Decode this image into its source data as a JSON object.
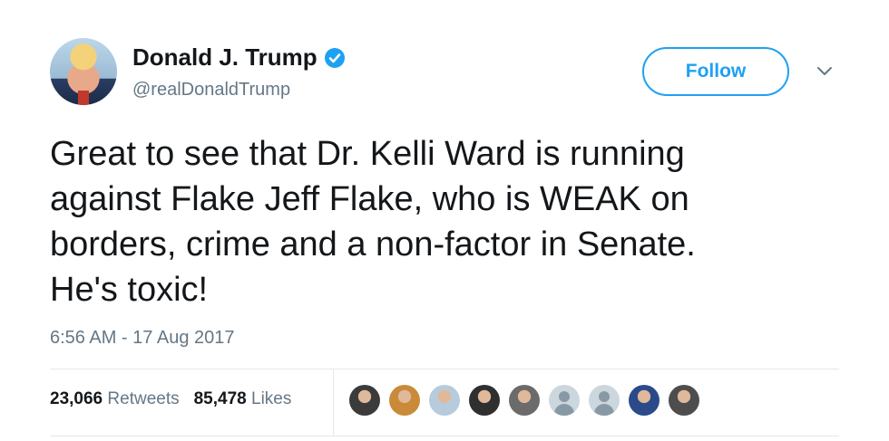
{
  "user": {
    "name": "Donald J. Trump",
    "handle": "@realDonaldTrump",
    "verified": true
  },
  "actions": {
    "follow_label": "Follow"
  },
  "tweet": {
    "text": "Great to see that Dr. Kelli Ward is running\nagainst Flake Jeff Flake, who is WEAK on\nborders, crime and a non-factor in Senate.\nHe's toxic!",
    "timestamp": "6:56 AM - 17 Aug 2017"
  },
  "stats": {
    "retweets_count": "23,066",
    "retweets_label": "Retweets",
    "likes_count": "85,478",
    "likes_label": "Likes"
  },
  "likers": [
    {
      "color": "#3b3b3b"
    },
    {
      "color": "#c98b3a"
    },
    {
      "color": "#b7cbdc"
    },
    {
      "color": "#2f2f2f"
    },
    {
      "color": "#6b6b6b"
    },
    {
      "color": "default"
    },
    {
      "color": "default"
    },
    {
      "color": "#2a4a8a"
    },
    {
      "color": "#4d4d4d"
    }
  ],
  "colors": {
    "accent": "#1da1f2",
    "secondary_text": "#657786"
  }
}
